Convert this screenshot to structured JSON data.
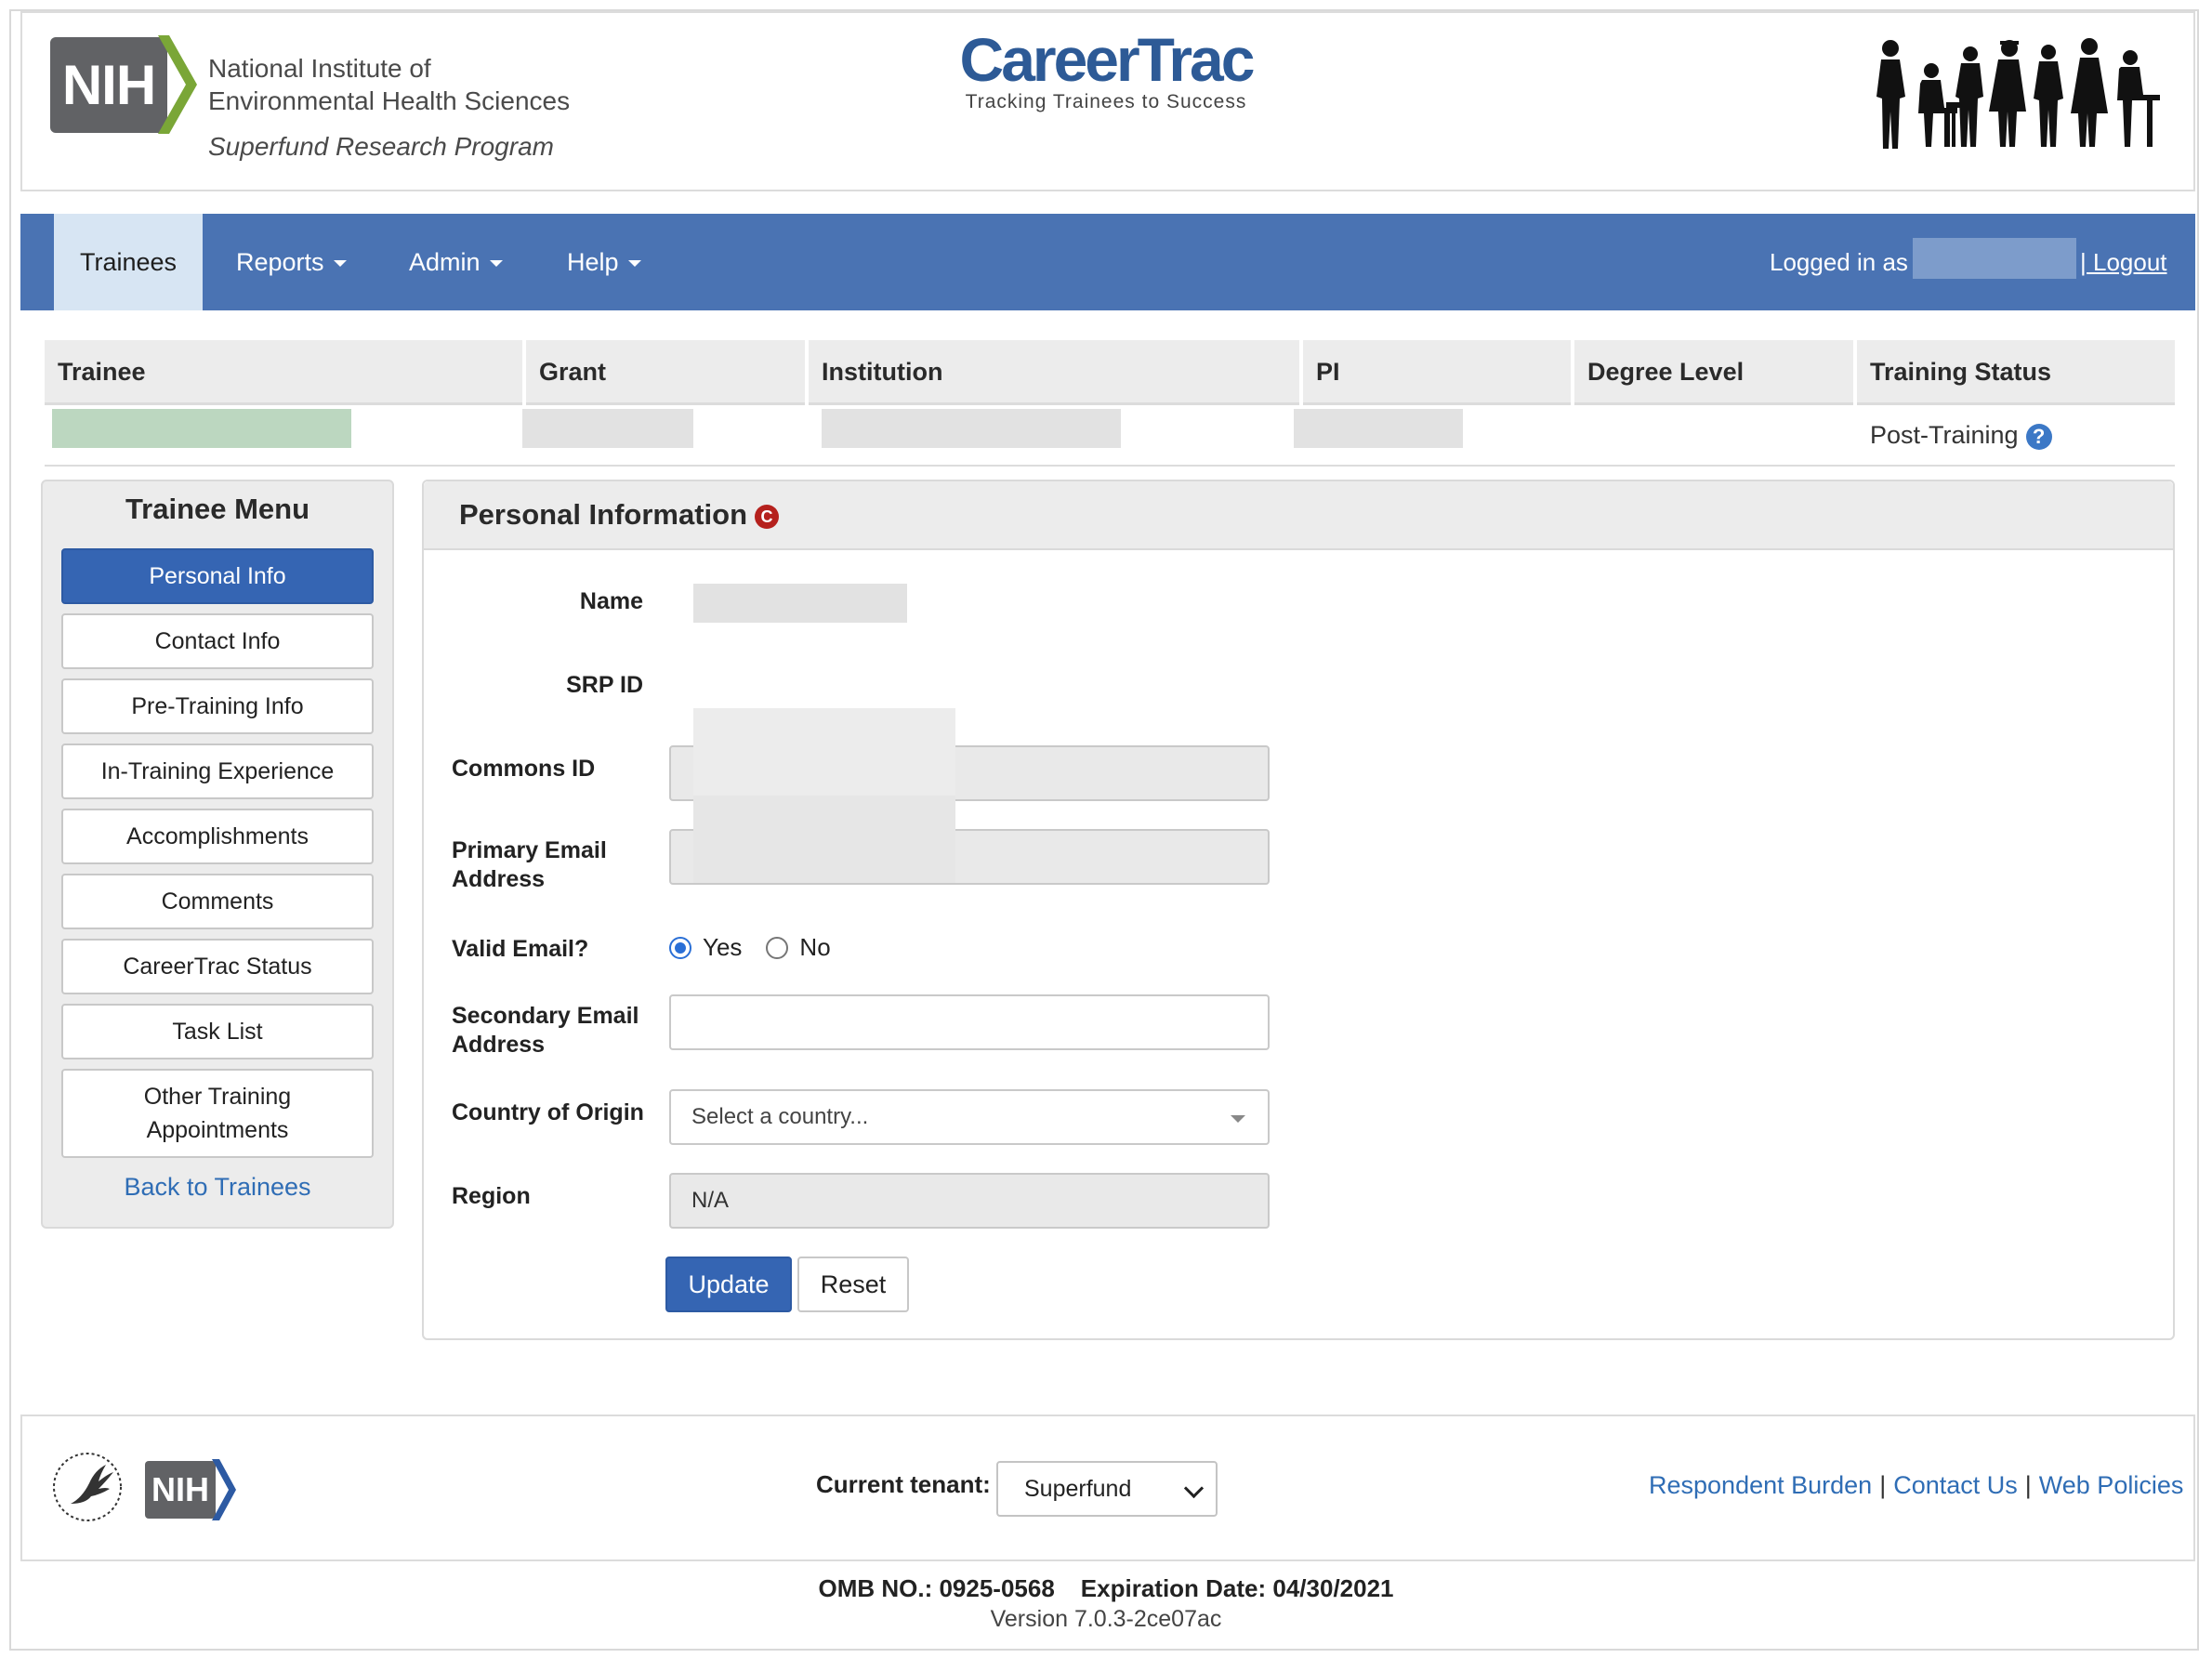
{
  "header": {
    "nih_logo_text": "NIH",
    "institute_line1": "National Institute of",
    "institute_line2": "Environmental Health Sciences",
    "program": "Superfund Research Program",
    "app_title": "CareerTrac",
    "app_tagline": "Tracking Trainees to Success"
  },
  "nav": {
    "items": [
      {
        "label": "Trainees"
      },
      {
        "label": "Reports"
      },
      {
        "label": "Admin"
      },
      {
        "label": "Help"
      }
    ],
    "logged_in_label": "Logged in as",
    "logout_label": "| Logout"
  },
  "trainee_table": {
    "headers": [
      "Trainee",
      "Grant",
      "Institution",
      "PI",
      "Degree Level",
      "Training Status"
    ],
    "training_status": "Post-Training",
    "help_glyph": "?"
  },
  "trainee_menu": {
    "title": "Trainee Menu",
    "items": [
      {
        "label": "Personal Info",
        "active": true
      },
      {
        "label": "Contact Info"
      },
      {
        "label": "Pre-Training Info"
      },
      {
        "label": "In-Training Experience"
      },
      {
        "label": "Accomplishments"
      },
      {
        "label": "Comments"
      },
      {
        "label": "CareerTrac Status"
      },
      {
        "label": "Task List"
      },
      {
        "label": "Other Training Appointments"
      }
    ],
    "back_link": "Back to Trainees"
  },
  "personal_info": {
    "title": "Personal Information",
    "badge": "C",
    "fields": {
      "name_label": "Name",
      "srp_id_label": "SRP ID",
      "commons_id_label": "Commons ID",
      "primary_email_label": "Primary Email Address",
      "valid_email_label": "Valid Email?",
      "valid_yes": "Yes",
      "valid_no": "No",
      "valid_email_value": "Yes",
      "secondary_email_label": "Secondary Email Address",
      "secondary_email_value": "",
      "country_label": "Country of Origin",
      "country_placeholder": "Select a country...",
      "region_label": "Region",
      "region_value": "N/A"
    },
    "update_label": "Update",
    "reset_label": "Reset"
  },
  "footer": {
    "tenant_label": "Current tenant:",
    "tenant_value": "Superfund",
    "links": [
      "Respondent Burden",
      "Contact Us",
      "Web Policies"
    ],
    "omb_no": "OMB NO.: 0925-0568",
    "expiration": "Expiration Date: 04/30/2021",
    "version": "Version 7.0.3-2ce07ac"
  },
  "colors": {
    "navbar": "#4a73b3",
    "primary_button": "#3565b3",
    "link": "#2f6db5",
    "brand_title": "#2d5a96",
    "badge_red": "#b5211d"
  }
}
